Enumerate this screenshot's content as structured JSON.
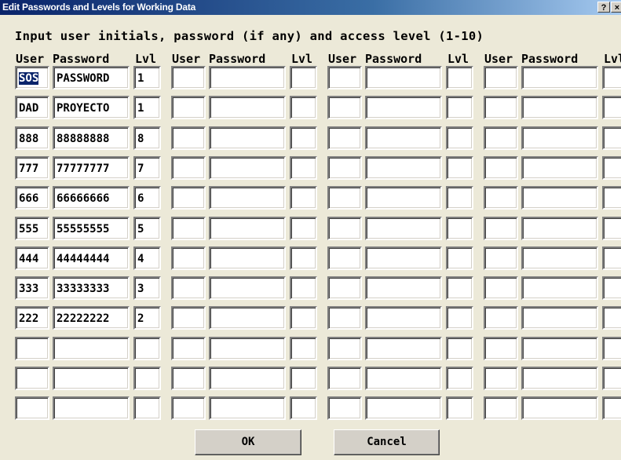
{
  "window": {
    "title": "Edit Passwords and Levels for Working Data",
    "help_label": "?",
    "close_label": "×"
  },
  "instructions": "Input user initials, password (if any) and access level (1-10)",
  "headers": {
    "user": "User",
    "password": "Password",
    "level": "Lvl"
  },
  "entries": [
    {
      "user": "SOS",
      "password": "PASSWORD",
      "level": "1"
    },
    {
      "user": "DAD",
      "password": "PROYECTO",
      "level": "1"
    },
    {
      "user": "888",
      "password": "88888888",
      "level": "8"
    },
    {
      "user": "777",
      "password": "77777777",
      "level": "7"
    },
    {
      "user": "666",
      "password": "66666666",
      "level": "6"
    },
    {
      "user": "555",
      "password": "55555555",
      "level": "5"
    },
    {
      "user": "444",
      "password": "44444444",
      "level": "4"
    },
    {
      "user": "333",
      "password": "33333333",
      "level": "3"
    },
    {
      "user": "222",
      "password": "22222222",
      "level": "2"
    },
    {
      "user": "",
      "password": "",
      "level": ""
    },
    {
      "user": "",
      "password": "",
      "level": ""
    },
    {
      "user": "",
      "password": "",
      "level": ""
    }
  ],
  "buttons": {
    "ok": "OK",
    "cancel": "Cancel"
  }
}
